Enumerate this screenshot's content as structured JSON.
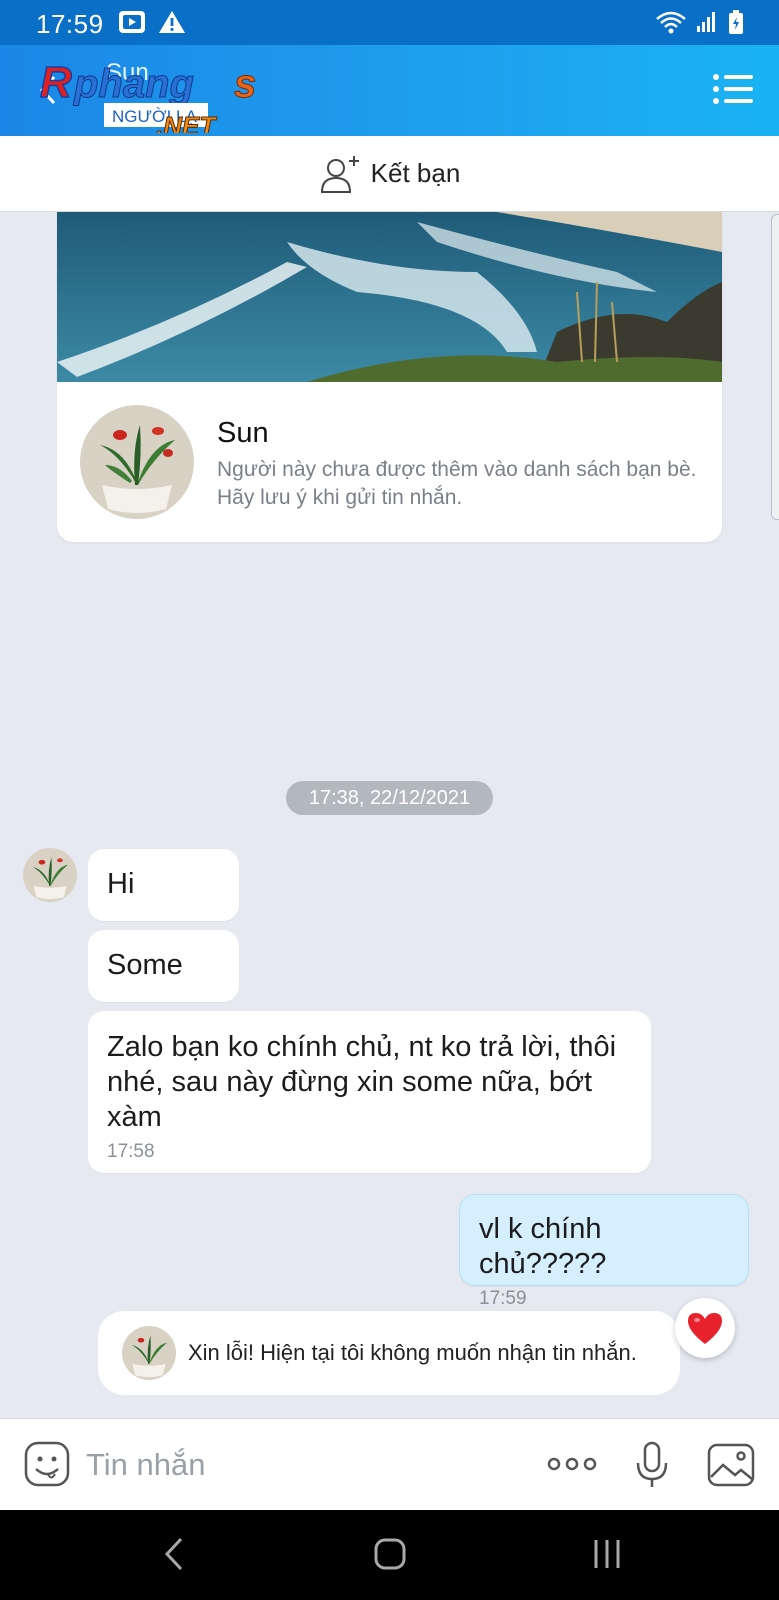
{
  "status_bar": {
    "time": "17:59"
  },
  "header": {
    "contact_name": "Sun",
    "watermark_top": "Phang",
    "watermark_mid": "NGƯỜI LẠ",
    "watermark_bottom": ".NET"
  },
  "add_friend": {
    "label": "Kết bạn"
  },
  "profile_card": {
    "name": "Sun",
    "note": "Người này chưa được thêm vào danh sách bạn bè. Hãy lưu ý khi gửi tin nhắn."
  },
  "conversation": {
    "date_divider": "17:38, 22/12/2021",
    "messages": [
      {
        "sender": "contact",
        "text": "Hi"
      },
      {
        "sender": "contact",
        "text": "Some"
      },
      {
        "sender": "contact",
        "text": "Zalo bạn ko chính chủ, nt ko trả lời, thôi nhé, sau này đừng xin some nữa, bớt xàm",
        "time": "17:58"
      },
      {
        "sender": "me",
        "text": "vl k chính chủ?????",
        "time": "17:59"
      }
    ],
    "notice": "Xin lỗi! Hiện tại tôi không muốn nhận tin nhắn."
  },
  "composer": {
    "placeholder": "Tin nhắn"
  },
  "colors": {
    "header": "#1ea1ef",
    "status_bar": "#0a6fc7",
    "my_bubble": "#d6efff",
    "background": "#e6e9f0"
  },
  "icons": [
    "back-arrow",
    "menu-list",
    "add-person",
    "heart",
    "emoji",
    "more-dots",
    "microphone",
    "image",
    "nav-back",
    "nav-home",
    "nav-recent"
  ]
}
